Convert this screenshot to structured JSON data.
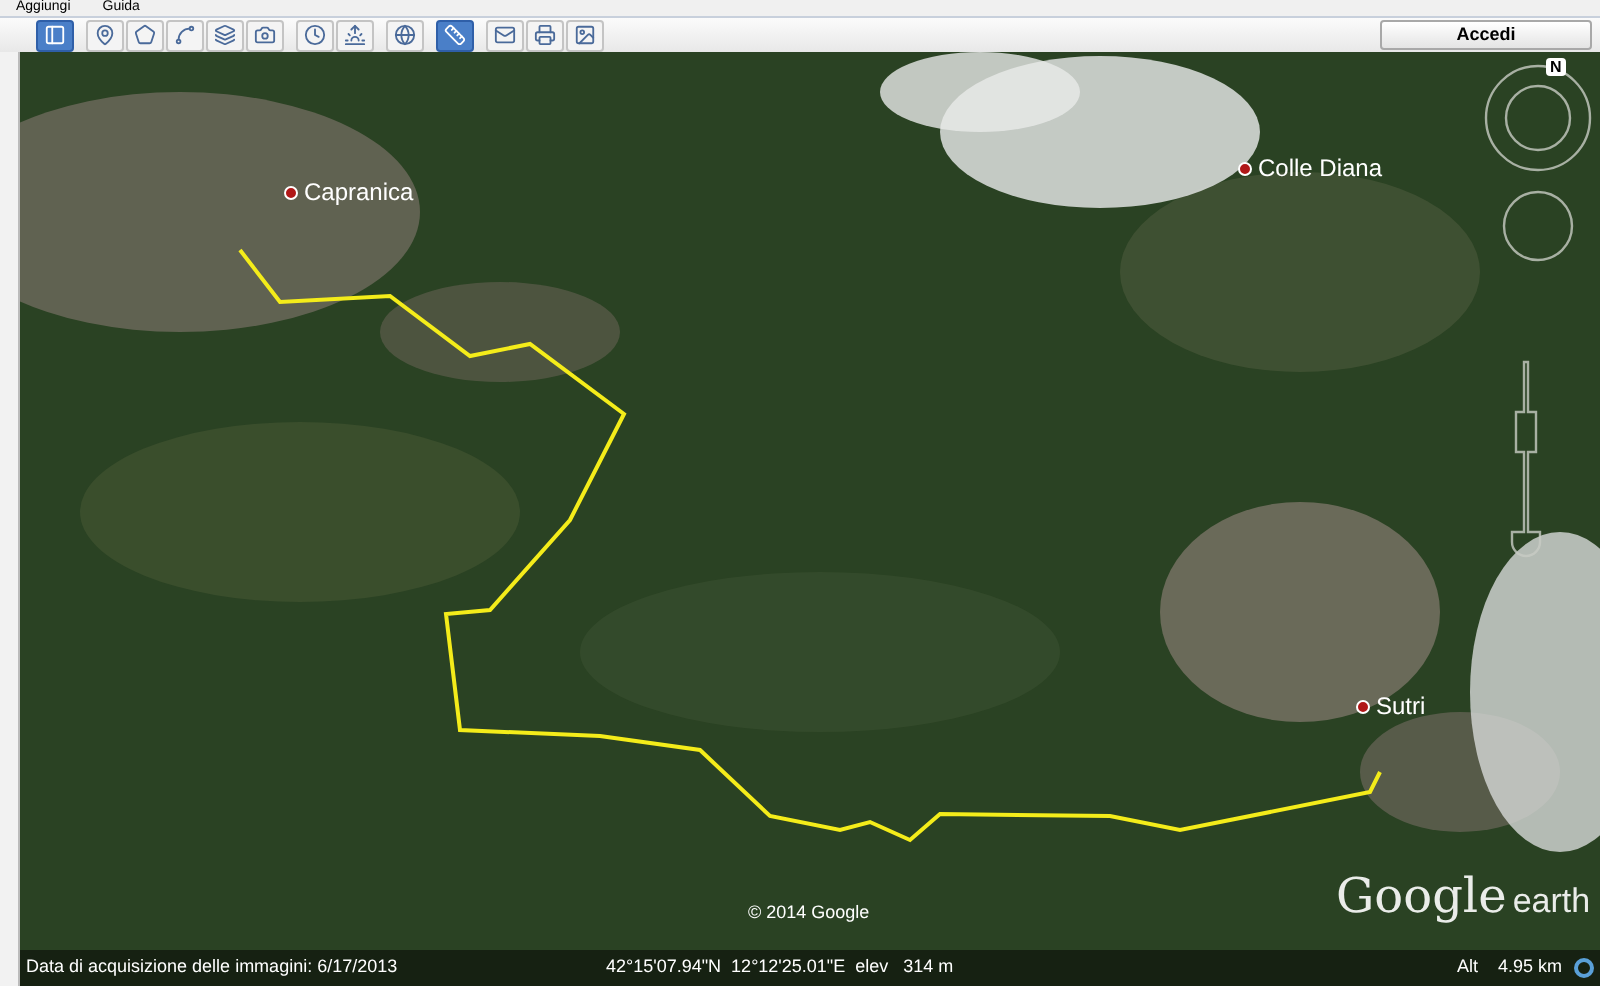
{
  "menu": [
    "Aggiungi",
    "Guida"
  ],
  "toolbar": [
    [
      {
        "selected": true
      }
    ],
    [
      {
        "selected": false
      },
      {
        "selected": false
      },
      {
        "selected": false
      },
      {
        "selected": false
      },
      {
        "selected": false
      }
    ],
    [
      {
        "selected": false
      },
      {
        "selected": false
      }
    ],
    [
      {
        "selected": false
      }
    ],
    [
      {
        "selected": true
      }
    ],
    [
      {
        "selected": false
      },
      {
        "selected": false
      },
      {
        "selected": false
      }
    ]
  ],
  "sign_in": "Accedi",
  "map": {
    "places": [
      "Capranica",
      "Colle Diana",
      "Sutri"
    ],
    "copyright": "© 2014 Google",
    "logo": {
      "brand": "Google",
      "product": "earth"
    },
    "compass": "N"
  },
  "status_bar": {
    "imagery_date": "Data di acquisizione delle immagini: 6/17/2013",
    "coordinates": "42°15'07.94\"N  12°12'25.01\"E  elev   314 m",
    "alt_label": "Alt",
    "alt_value": "4.95 km"
  }
}
